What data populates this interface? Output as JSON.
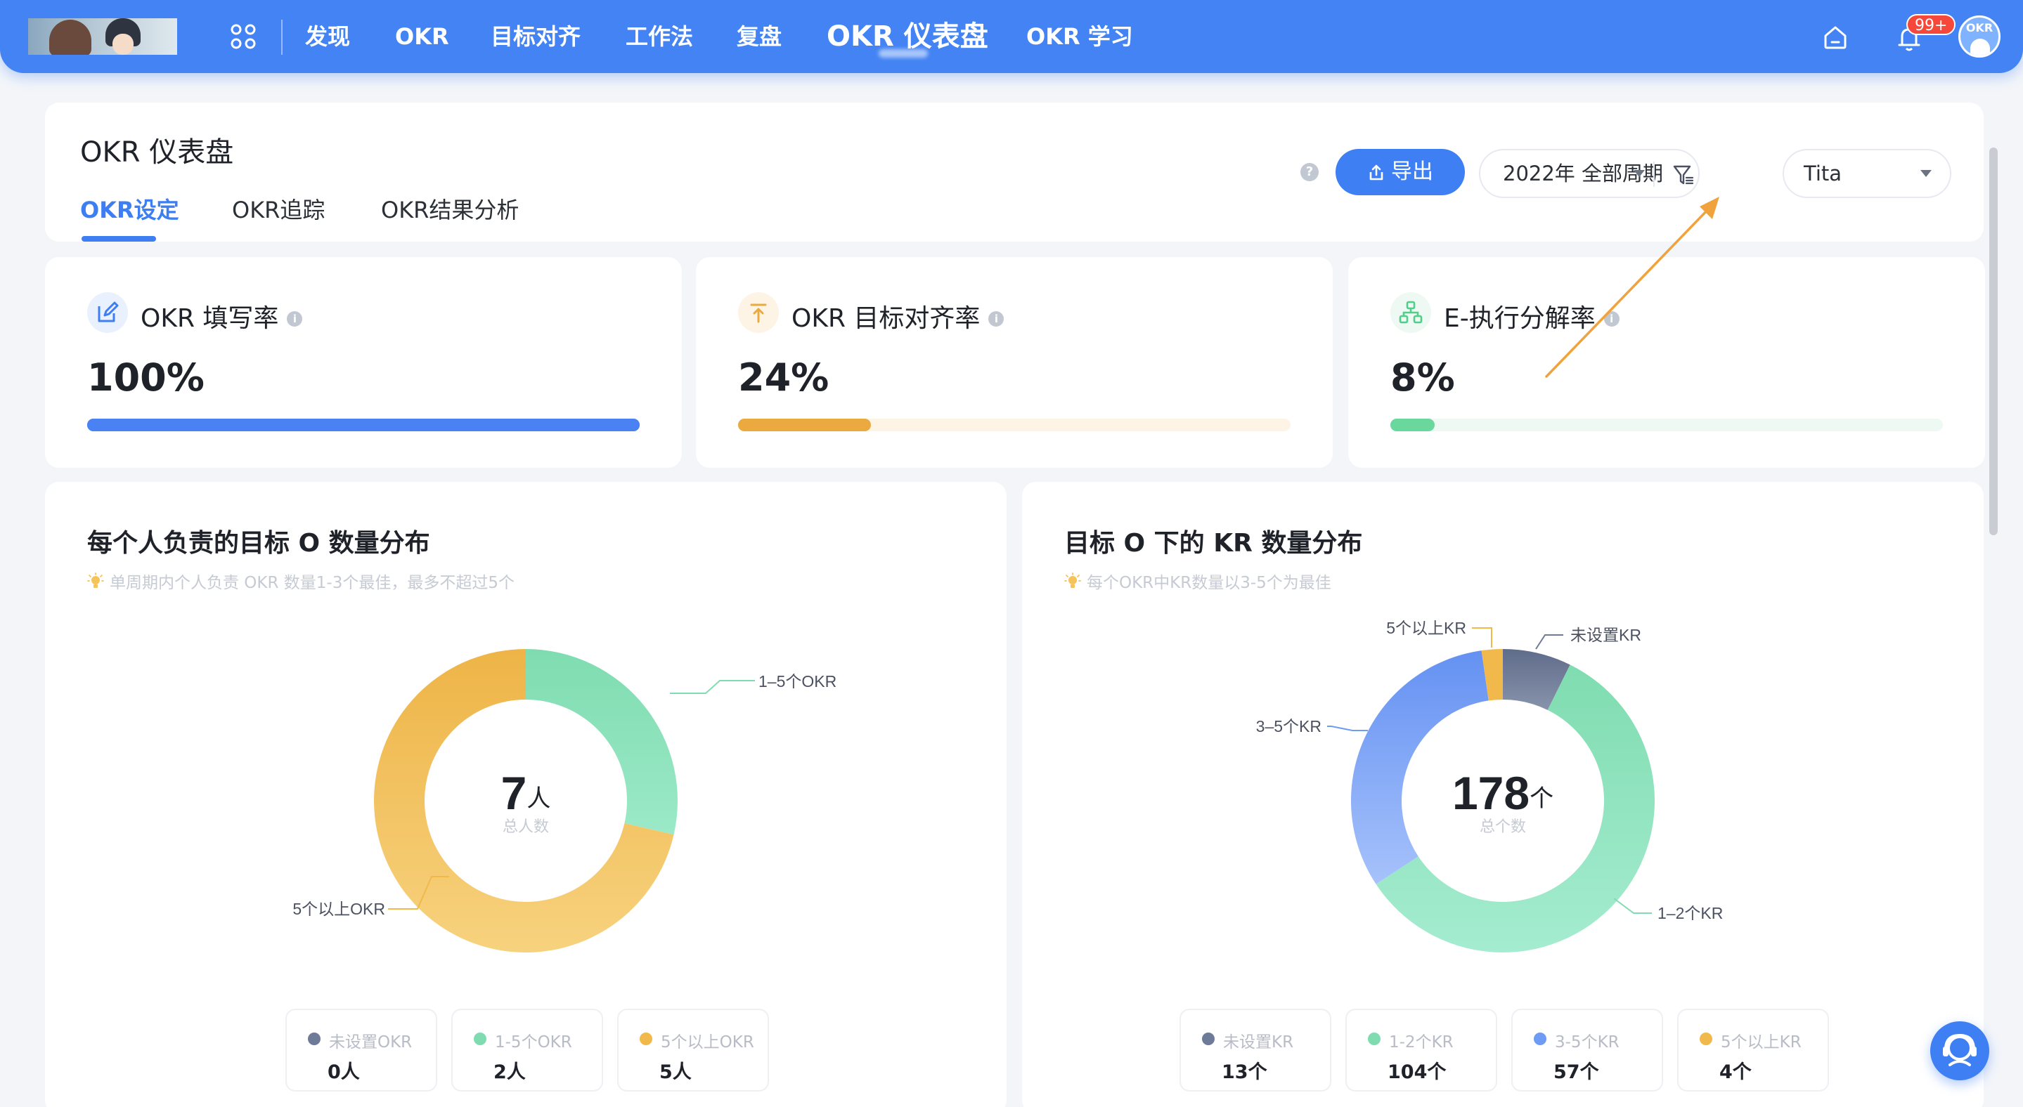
{
  "topbar": {
    "nav": [
      "发现",
      "OKR",
      "目标对齐",
      "工作法",
      "复盘",
      "OKR 仪表盘",
      "OKR 学习"
    ],
    "active_nav": "OKR 仪表盘",
    "notification_badge": "99+",
    "avatar_text": "OKR"
  },
  "header": {
    "title": "OKR 仪表盘",
    "tabs": [
      "OKR设定",
      "OKR追踪",
      "OKR结果分析"
    ],
    "active_tab": "OKR设定",
    "help_icon": "?",
    "export_label": "导出",
    "period_value": "2022年 全部周期",
    "user_value": "Tita"
  },
  "metrics": [
    {
      "title": "OKR 填写率",
      "value": "100%",
      "progress": 1.0,
      "color": "#4a82f4",
      "track": "#4a82f4",
      "icon": "edit-icon"
    },
    {
      "title": "OKR 目标对齐率",
      "value": "24%",
      "progress": 0.24,
      "color": "#eaaa3f",
      "track": "#fdf4e6",
      "icon": "align-top-icon"
    },
    {
      "title": "E-执行分解率",
      "value": "8%",
      "progress": 0.08,
      "color": "#6ad79d",
      "track": "#edf9f2",
      "icon": "hierarchy-icon"
    }
  ],
  "info_glyph": "i",
  "chart_left": {
    "title": "每个人负责的目标 O 数量分布",
    "tip": "单周期内个人负责 OKR 数量1-3个最佳，最多不超过5个",
    "center_value": "7",
    "center_unit": "人",
    "center_label": "总人数",
    "slice_labels": [
      "1–5个OKR",
      "5个以上OKR"
    ],
    "legend": [
      {
        "name": "未设置OKR",
        "value": "0人",
        "color": "#6d7a98"
      },
      {
        "name": "1-5个OKR",
        "value": "2人",
        "color": "#7fdcb0"
      },
      {
        "name": "5个以上OKR",
        "value": "5人",
        "color": "#f1b94b"
      }
    ]
  },
  "chart_right": {
    "title": "目标 O 下的 KR 数量分布",
    "tip": "每个OKR中KR数量以3-5个为最佳",
    "center_value": "178",
    "center_unit": "个",
    "center_label": "总个数",
    "slice_labels": [
      "未设置KR",
      "1–2个KR",
      "3–5个KR",
      "5个以上KR"
    ],
    "legend": [
      {
        "name": "未设置KR",
        "value": "13个",
        "color": "#6d7a98"
      },
      {
        "name": "1-2个KR",
        "value": "104个",
        "color": "#7fdcb0"
      },
      {
        "name": "3-5个KR",
        "value": "57个",
        "color": "#6e9bf4"
      },
      {
        "name": "5个以上KR",
        "value": "4个",
        "color": "#f1b94b"
      }
    ]
  },
  "chart_data": [
    {
      "type": "pie",
      "title": "每个人负责的目标 O 数量分布",
      "categories": [
        "未设置OKR",
        "1-5个OKR",
        "5个以上OKR"
      ],
      "values": [
        0,
        2,
        5
      ],
      "colors": [
        "#6d7a98",
        "#7fdcb0",
        "#f1b94b"
      ],
      "donut": true,
      "total": 7
    },
    {
      "type": "pie",
      "title": "目标 O 下的 KR 数量分布",
      "categories": [
        "未设置KR",
        "1-2个KR",
        "3-5个KR",
        "5个以上KR"
      ],
      "values": [
        13,
        104,
        57,
        4
      ],
      "colors": [
        "#6d7a98",
        "#7fdcb0",
        "#6e9bf4",
        "#f1b94b"
      ],
      "donut": true,
      "total": 178
    }
  ]
}
